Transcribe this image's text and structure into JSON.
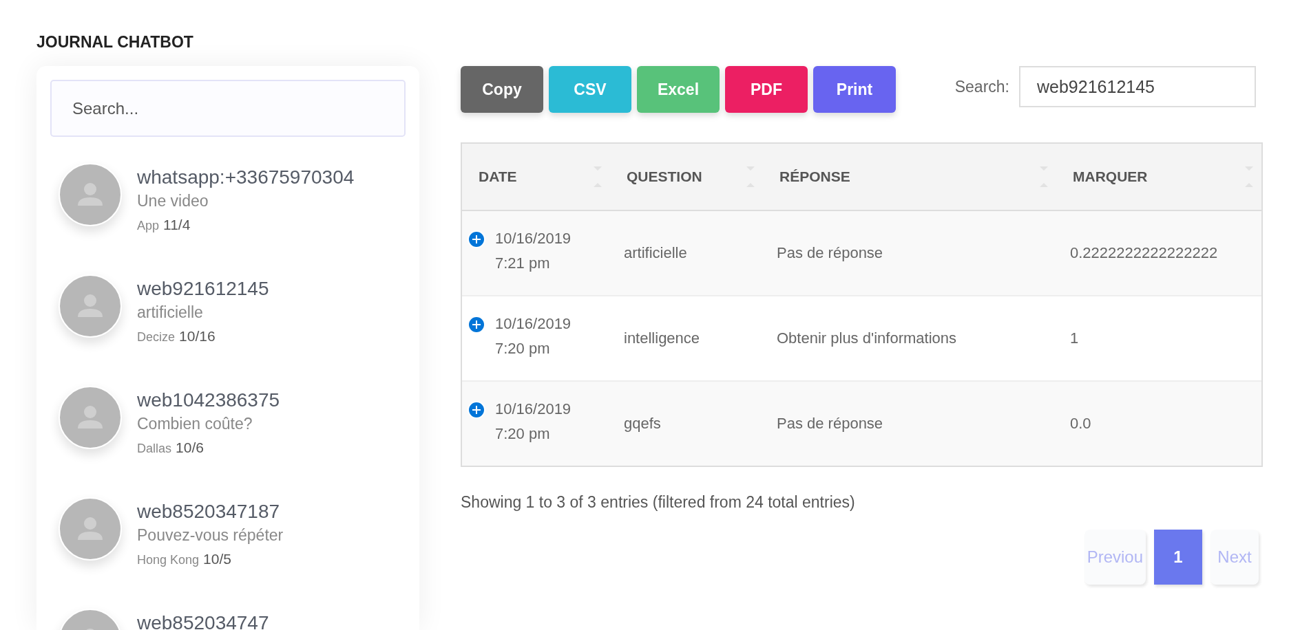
{
  "page_title": "JOURNAL CHATBOT",
  "contacts_panel": {
    "search": {
      "placeholder": "Search..."
    },
    "contacts": [
      {
        "name": "whatsapp:+33675970304",
        "message": "Une video",
        "location": "App",
        "date": "11/4"
      },
      {
        "name": "web921612145",
        "message": "artificielle",
        "location": "Decize",
        "date": "10/16"
      },
      {
        "name": "web1042386375",
        "message": "Combien coûte?",
        "location": "Dallas",
        "date": "10/6"
      },
      {
        "name": "web8520347187",
        "message": "Pouvez-vous répéter",
        "location": "Hong Kong",
        "date": "10/5"
      },
      {
        "name": "web852034747"
      }
    ]
  },
  "toolbar": {
    "buttons": [
      {
        "label": "Copy",
        "color": "#666666"
      },
      {
        "label": "CSV",
        "color": "#2bbbd5"
      },
      {
        "label": "Excel",
        "color": "#58c27a"
      },
      {
        "label": "PDF",
        "color": "#ec1f63"
      },
      {
        "label": "Print",
        "color": "#6864f0"
      }
    ],
    "search": {
      "label": "Search:",
      "value": "web921612145"
    }
  },
  "table": {
    "columns": [
      "DATE",
      "QUESTION",
      "RÉPONSE",
      "MARQUER"
    ],
    "rows": [
      {
        "date": "10/16/2019 7:21 pm",
        "question": "artificielle",
        "response": "Pas de réponse",
        "score": "0.2222222222222222"
      },
      {
        "date": "10/16/2019 7:20 pm",
        "question": "intelligence",
        "response": "Obtenir plus d'informations",
        "score": "1"
      },
      {
        "date": "10/16/2019 7:20 pm",
        "question": "gqefs",
        "response": "Pas de réponse",
        "score": "0.0"
      }
    ]
  },
  "info": "Showing 1 to 3 of 3 entries (filtered from 24 total entries)",
  "pagination": [
    {
      "label": "Previou",
      "kind": "prev",
      "selected": false,
      "disabled": true
    },
    {
      "label": "1",
      "kind": "page",
      "selected": true,
      "disabled": false
    },
    {
      "label": "Next",
      "kind": "next",
      "selected": false,
      "disabled": true
    }
  ]
}
